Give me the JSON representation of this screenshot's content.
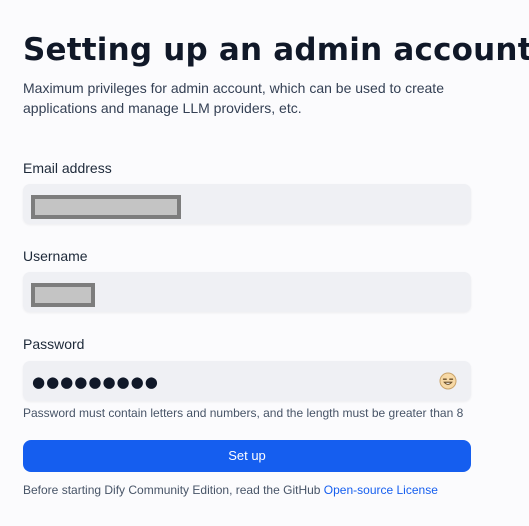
{
  "page": {
    "title": "Setting up an admin account",
    "subtitle": "Maximum privileges for admin account, which can be used to create applications and manage LLM providers, etc."
  },
  "form": {
    "email": {
      "label": "Email address",
      "value_state": "redacted"
    },
    "username": {
      "label": "Username",
      "value_state": "redacted"
    },
    "password": {
      "label": "Password",
      "masked_value": "●●●●●●●●●",
      "toggle_icon": "eye-toggle-icon",
      "hint": "Password must contain letters and numbers, and the length must be greater than 8"
    },
    "submit_label": "Set up"
  },
  "footer": {
    "text": "Before starting Dify Community Edition, read the GitHub ",
    "link_text": "Open-source License"
  },
  "colors": {
    "primary": "#155eef",
    "field_bg": "#eff0f4",
    "page_bg": "#fbfbfd"
  }
}
